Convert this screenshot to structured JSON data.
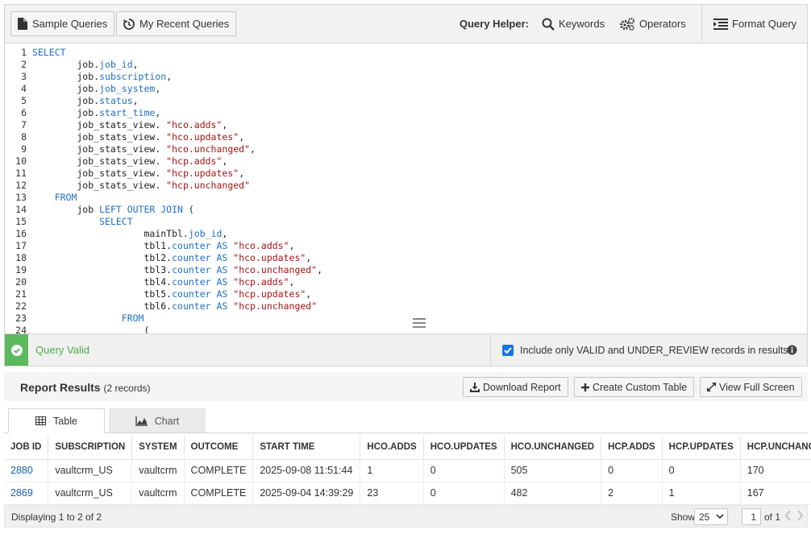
{
  "toolbar": {
    "sample_queries": "Sample Queries",
    "recent_queries": "My Recent Queries",
    "query_helper_label": "Query Helper:",
    "keywords": "Keywords",
    "operators": "Operators",
    "format_query": "Format Query"
  },
  "editor": {
    "lines": [
      {
        "n": "1",
        "code": [
          {
            "t": "SELECT",
            "c": "kw"
          }
        ]
      },
      {
        "n": "2",
        "code": [
          {
            "t": "        job."
          },
          {
            "t": "job_id",
            "c": "kw"
          },
          {
            "t": ","
          }
        ]
      },
      {
        "n": "3",
        "code": [
          {
            "t": "        job."
          },
          {
            "t": "subscription",
            "c": "kw"
          },
          {
            "t": ","
          }
        ]
      },
      {
        "n": "4",
        "code": [
          {
            "t": "        job."
          },
          {
            "t": "job_system",
            "c": "kw"
          },
          {
            "t": ","
          }
        ]
      },
      {
        "n": "5",
        "code": [
          {
            "t": "        job."
          },
          {
            "t": "status",
            "c": "kw"
          },
          {
            "t": ","
          }
        ]
      },
      {
        "n": "6",
        "code": [
          {
            "t": "        job."
          },
          {
            "t": "start_time",
            "c": "kw"
          },
          {
            "t": ","
          }
        ]
      },
      {
        "n": "7",
        "code": [
          {
            "t": "        job_stats_view. "
          },
          {
            "t": "\"hco.adds\"",
            "c": "str"
          },
          {
            "t": ","
          }
        ]
      },
      {
        "n": "8",
        "code": [
          {
            "t": "        job_stats_view. "
          },
          {
            "t": "\"hco.updates\"",
            "c": "str"
          },
          {
            "t": ","
          }
        ]
      },
      {
        "n": "9",
        "code": [
          {
            "t": "        job_stats_view. "
          },
          {
            "t": "\"hco.unchanged\"",
            "c": "str"
          },
          {
            "t": ","
          }
        ]
      },
      {
        "n": "10",
        "code": [
          {
            "t": "        job_stats_view. "
          },
          {
            "t": "\"hcp.adds\"",
            "c": "str"
          },
          {
            "t": ","
          }
        ]
      },
      {
        "n": "11",
        "code": [
          {
            "t": "        job_stats_view. "
          },
          {
            "t": "\"hcp.updates\"",
            "c": "str"
          },
          {
            "t": ","
          }
        ]
      },
      {
        "n": "12",
        "code": [
          {
            "t": "        job_stats_view. "
          },
          {
            "t": "\"hcp.unchanged\"",
            "c": "str"
          }
        ]
      },
      {
        "n": "13",
        "code": [
          {
            "t": "    "
          },
          {
            "t": "FROM",
            "c": "kw"
          }
        ]
      },
      {
        "n": "14",
        "code": [
          {
            "t": "        job "
          },
          {
            "t": "LEFT OUTER JOIN",
            "c": "kw"
          },
          {
            "t": " ("
          }
        ]
      },
      {
        "n": "15",
        "code": [
          {
            "t": "            "
          },
          {
            "t": "SELECT",
            "c": "kw"
          }
        ]
      },
      {
        "n": "16",
        "code": [
          {
            "t": "                    mainTbl."
          },
          {
            "t": "job_id",
            "c": "kw"
          },
          {
            "t": ","
          }
        ]
      },
      {
        "n": "17",
        "code": [
          {
            "t": "                    tbl1."
          },
          {
            "t": "counter AS",
            "c": "kw"
          },
          {
            "t": " "
          },
          {
            "t": "\"hco.adds\"",
            "c": "str"
          },
          {
            "t": ","
          }
        ]
      },
      {
        "n": "18",
        "code": [
          {
            "t": "                    tbl2."
          },
          {
            "t": "counter AS",
            "c": "kw"
          },
          {
            "t": " "
          },
          {
            "t": "\"hco.updates\"",
            "c": "str"
          },
          {
            "t": ","
          }
        ]
      },
      {
        "n": "19",
        "code": [
          {
            "t": "                    tbl3."
          },
          {
            "t": "counter AS",
            "c": "kw"
          },
          {
            "t": " "
          },
          {
            "t": "\"hco.unchanged\"",
            "c": "str"
          },
          {
            "t": ","
          }
        ]
      },
      {
        "n": "20",
        "code": [
          {
            "t": "                    tbl4."
          },
          {
            "t": "counter AS",
            "c": "kw"
          },
          {
            "t": " "
          },
          {
            "t": "\"hcp.adds\"",
            "c": "str"
          },
          {
            "t": ","
          }
        ]
      },
      {
        "n": "21",
        "code": [
          {
            "t": "                    tbl5."
          },
          {
            "t": "counter AS",
            "c": "kw"
          },
          {
            "t": " "
          },
          {
            "t": "\"hcp.updates\"",
            "c": "str"
          },
          {
            "t": ","
          }
        ]
      },
      {
        "n": "22",
        "code": [
          {
            "t": "                    tbl6."
          },
          {
            "t": "counter AS",
            "c": "kw"
          },
          {
            "t": " "
          },
          {
            "t": "\"hcp.unchanged\"",
            "c": "str"
          }
        ]
      },
      {
        "n": "23",
        "code": [
          {
            "t": "                "
          },
          {
            "t": "FROM",
            "c": "kw"
          }
        ]
      },
      {
        "n": "24",
        "code": [
          {
            "t": "                    ("
          }
        ]
      }
    ]
  },
  "status": {
    "valid_text": "Query Valid",
    "include_label": "Include only VALID and UNDER_REVIEW records in results.",
    "include_checked": true
  },
  "report": {
    "title": "Report Results",
    "count": "(2 records)",
    "download": "Download Report",
    "create_table": "Create Custom Table",
    "full_screen": "View Full Screen"
  },
  "tabs": {
    "table": "Table",
    "chart": "Chart"
  },
  "table": {
    "columns": [
      "JOB ID",
      "SUBSCRIPTION",
      "SYSTEM",
      "OUTCOME",
      "START TIME",
      "HCO.ADDS",
      "HCO.UPDATES",
      "HCO.UNCHANGED",
      "HCP.ADDS",
      "HCP.UPDATES",
      "HCP.UNCHANGED"
    ],
    "rows": [
      [
        "2880",
        "vaultcrm_US",
        "vaultcrm",
        "COMPLETE",
        "2025-09-08 11:51:44",
        "1",
        "0",
        "505",
        "0",
        "0",
        "170"
      ],
      [
        "2869",
        "vaultcrm_US",
        "vaultcrm",
        "COMPLETE",
        "2025-09-04 14:39:29",
        "23",
        "0",
        "482",
        "2",
        "1",
        "167"
      ]
    ]
  },
  "footer": {
    "displaying": "Displaying 1 to 2 of 2",
    "show_label": "Show",
    "page_size": "25",
    "page": "1",
    "of_label": "of 1"
  },
  "colors": {
    "accent": "#1a73e8",
    "valid": "#5cb85c",
    "keyword": "#1e6fc7",
    "string": "#a31515"
  }
}
